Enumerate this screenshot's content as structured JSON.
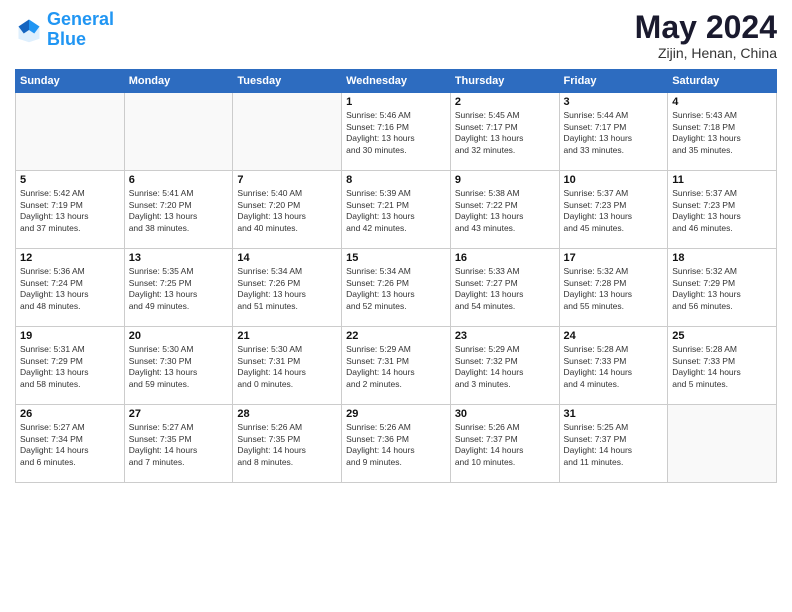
{
  "header": {
    "logo_general": "General",
    "logo_blue": "Blue",
    "month_title": "May 2024",
    "location": "Zijin, Henan, China"
  },
  "days_of_week": [
    "Sunday",
    "Monday",
    "Tuesday",
    "Wednesday",
    "Thursday",
    "Friday",
    "Saturday"
  ],
  "weeks": [
    [
      {
        "day": "",
        "lines": []
      },
      {
        "day": "",
        "lines": []
      },
      {
        "day": "",
        "lines": []
      },
      {
        "day": "1",
        "lines": [
          "Sunrise: 5:46 AM",
          "Sunset: 7:16 PM",
          "Daylight: 13 hours",
          "and 30 minutes."
        ]
      },
      {
        "day": "2",
        "lines": [
          "Sunrise: 5:45 AM",
          "Sunset: 7:17 PM",
          "Daylight: 13 hours",
          "and 32 minutes."
        ]
      },
      {
        "day": "3",
        "lines": [
          "Sunrise: 5:44 AM",
          "Sunset: 7:17 PM",
          "Daylight: 13 hours",
          "and 33 minutes."
        ]
      },
      {
        "day": "4",
        "lines": [
          "Sunrise: 5:43 AM",
          "Sunset: 7:18 PM",
          "Daylight: 13 hours",
          "and 35 minutes."
        ]
      }
    ],
    [
      {
        "day": "5",
        "lines": [
          "Sunrise: 5:42 AM",
          "Sunset: 7:19 PM",
          "Daylight: 13 hours",
          "and 37 minutes."
        ]
      },
      {
        "day": "6",
        "lines": [
          "Sunrise: 5:41 AM",
          "Sunset: 7:20 PM",
          "Daylight: 13 hours",
          "and 38 minutes."
        ]
      },
      {
        "day": "7",
        "lines": [
          "Sunrise: 5:40 AM",
          "Sunset: 7:20 PM",
          "Daylight: 13 hours",
          "and 40 minutes."
        ]
      },
      {
        "day": "8",
        "lines": [
          "Sunrise: 5:39 AM",
          "Sunset: 7:21 PM",
          "Daylight: 13 hours",
          "and 42 minutes."
        ]
      },
      {
        "day": "9",
        "lines": [
          "Sunrise: 5:38 AM",
          "Sunset: 7:22 PM",
          "Daylight: 13 hours",
          "and 43 minutes."
        ]
      },
      {
        "day": "10",
        "lines": [
          "Sunrise: 5:37 AM",
          "Sunset: 7:23 PM",
          "Daylight: 13 hours",
          "and 45 minutes."
        ]
      },
      {
        "day": "11",
        "lines": [
          "Sunrise: 5:37 AM",
          "Sunset: 7:23 PM",
          "Daylight: 13 hours",
          "and 46 minutes."
        ]
      }
    ],
    [
      {
        "day": "12",
        "lines": [
          "Sunrise: 5:36 AM",
          "Sunset: 7:24 PM",
          "Daylight: 13 hours",
          "and 48 minutes."
        ]
      },
      {
        "day": "13",
        "lines": [
          "Sunrise: 5:35 AM",
          "Sunset: 7:25 PM",
          "Daylight: 13 hours",
          "and 49 minutes."
        ]
      },
      {
        "day": "14",
        "lines": [
          "Sunrise: 5:34 AM",
          "Sunset: 7:26 PM",
          "Daylight: 13 hours",
          "and 51 minutes."
        ]
      },
      {
        "day": "15",
        "lines": [
          "Sunrise: 5:34 AM",
          "Sunset: 7:26 PM",
          "Daylight: 13 hours",
          "and 52 minutes."
        ]
      },
      {
        "day": "16",
        "lines": [
          "Sunrise: 5:33 AM",
          "Sunset: 7:27 PM",
          "Daylight: 13 hours",
          "and 54 minutes."
        ]
      },
      {
        "day": "17",
        "lines": [
          "Sunrise: 5:32 AM",
          "Sunset: 7:28 PM",
          "Daylight: 13 hours",
          "and 55 minutes."
        ]
      },
      {
        "day": "18",
        "lines": [
          "Sunrise: 5:32 AM",
          "Sunset: 7:29 PM",
          "Daylight: 13 hours",
          "and 56 minutes."
        ]
      }
    ],
    [
      {
        "day": "19",
        "lines": [
          "Sunrise: 5:31 AM",
          "Sunset: 7:29 PM",
          "Daylight: 13 hours",
          "and 58 minutes."
        ]
      },
      {
        "day": "20",
        "lines": [
          "Sunrise: 5:30 AM",
          "Sunset: 7:30 PM",
          "Daylight: 13 hours",
          "and 59 minutes."
        ]
      },
      {
        "day": "21",
        "lines": [
          "Sunrise: 5:30 AM",
          "Sunset: 7:31 PM",
          "Daylight: 14 hours",
          "and 0 minutes."
        ]
      },
      {
        "day": "22",
        "lines": [
          "Sunrise: 5:29 AM",
          "Sunset: 7:31 PM",
          "Daylight: 14 hours",
          "and 2 minutes."
        ]
      },
      {
        "day": "23",
        "lines": [
          "Sunrise: 5:29 AM",
          "Sunset: 7:32 PM",
          "Daylight: 14 hours",
          "and 3 minutes."
        ]
      },
      {
        "day": "24",
        "lines": [
          "Sunrise: 5:28 AM",
          "Sunset: 7:33 PM",
          "Daylight: 14 hours",
          "and 4 minutes."
        ]
      },
      {
        "day": "25",
        "lines": [
          "Sunrise: 5:28 AM",
          "Sunset: 7:33 PM",
          "Daylight: 14 hours",
          "and 5 minutes."
        ]
      }
    ],
    [
      {
        "day": "26",
        "lines": [
          "Sunrise: 5:27 AM",
          "Sunset: 7:34 PM",
          "Daylight: 14 hours",
          "and 6 minutes."
        ]
      },
      {
        "day": "27",
        "lines": [
          "Sunrise: 5:27 AM",
          "Sunset: 7:35 PM",
          "Daylight: 14 hours",
          "and 7 minutes."
        ]
      },
      {
        "day": "28",
        "lines": [
          "Sunrise: 5:26 AM",
          "Sunset: 7:35 PM",
          "Daylight: 14 hours",
          "and 8 minutes."
        ]
      },
      {
        "day": "29",
        "lines": [
          "Sunrise: 5:26 AM",
          "Sunset: 7:36 PM",
          "Daylight: 14 hours",
          "and 9 minutes."
        ]
      },
      {
        "day": "30",
        "lines": [
          "Sunrise: 5:26 AM",
          "Sunset: 7:37 PM",
          "Daylight: 14 hours",
          "and 10 minutes."
        ]
      },
      {
        "day": "31",
        "lines": [
          "Sunrise: 5:25 AM",
          "Sunset: 7:37 PM",
          "Daylight: 14 hours",
          "and 11 minutes."
        ]
      },
      {
        "day": "",
        "lines": []
      }
    ]
  ]
}
